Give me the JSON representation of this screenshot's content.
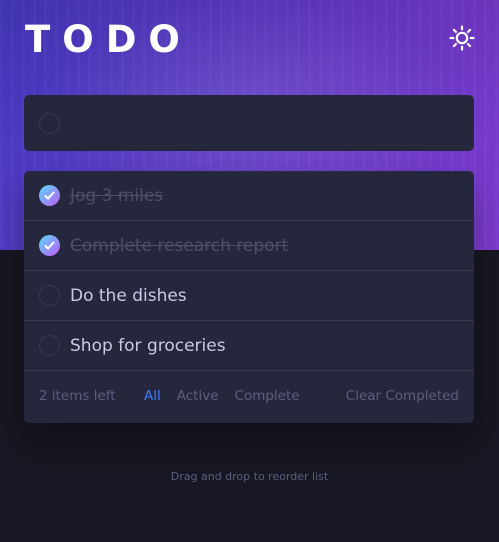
{
  "app": {
    "title": "TODO"
  },
  "new_todo": {
    "placeholder": ""
  },
  "todos": [
    {
      "text": "Jog 3 miles",
      "completed": true
    },
    {
      "text": "Complete research report",
      "completed": true
    },
    {
      "text": "Do the dishes",
      "completed": false
    },
    {
      "text": "Shop for groceries",
      "completed": false
    }
  ],
  "footer": {
    "items_left": "2 items left",
    "filters": [
      "All",
      "Active",
      "Complete"
    ],
    "active_filter": "All",
    "clear_label": "Clear Completed"
  },
  "hint": "Drag and drop to reorder list",
  "colors": {
    "accent": "#3a7cfd",
    "check_gradient_start": "#57ddff",
    "check_gradient_end": "#c058f3",
    "card": "#25273d",
    "background": "#181824"
  },
  "icons": {
    "theme_toggle": "sun-icon",
    "check": "check-icon"
  }
}
